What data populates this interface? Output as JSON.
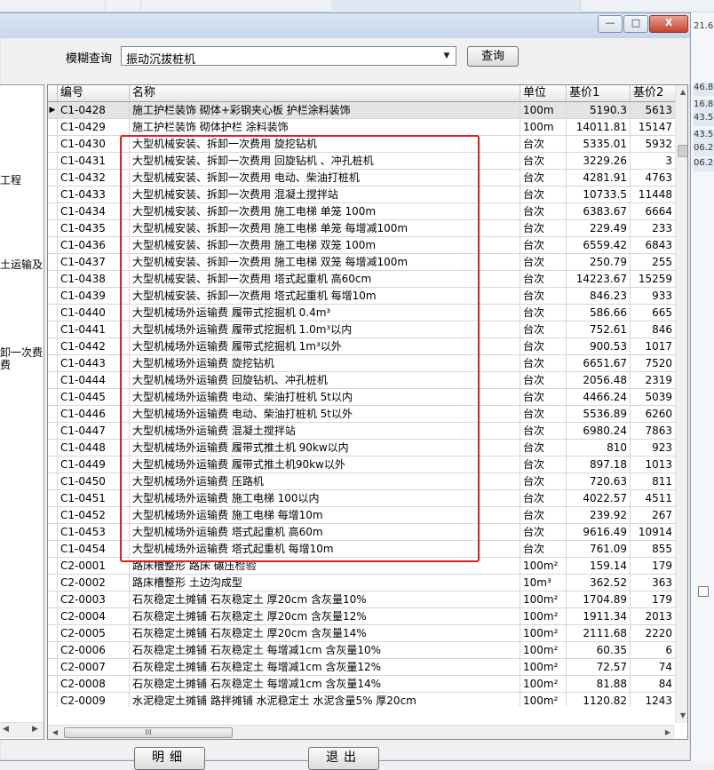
{
  "background": {
    "right_values": [
      "21.6",
      "46.8",
      "16.8",
      "43.5",
      "43.5",
      "06.2",
      "06.2"
    ]
  },
  "window": {
    "min_label": "—",
    "max_label": "□",
    "close_label": "X"
  },
  "filter": {
    "label": "模糊查询",
    "value": "振动沉拔桩机",
    "query_label": "查询"
  },
  "tree": {
    "items": [
      "工程",
      "土运输及",
      "卸一次费",
      "费"
    ]
  },
  "grid": {
    "columns": [
      "编号",
      "名称",
      "单位",
      "基价1",
      "基价2"
    ],
    "rows": [
      {
        "code": "C1-0428",
        "name": "施工护栏装饰 砌体+彩钢夹心板 护栏涂料装饰",
        "unit": "100m",
        "p1": "5190.3",
        "p2": "5613"
      },
      {
        "code": "C1-0429",
        "name": "施工护栏装饰 砌体护栏 涂料装饰",
        "unit": "100m",
        "p1": "14011.81",
        "p2": "15147"
      },
      {
        "code": "C1-0430",
        "name": "大型机械安装、拆卸一次费用 旋挖钻机",
        "unit": "台次",
        "p1": "5335.01",
        "p2": "5932"
      },
      {
        "code": "C1-0431",
        "name": "大型机械安装、拆卸一次费用 回旋钻机 、冲孔桩机",
        "unit": "台次",
        "p1": "3229.26",
        "p2": "3"
      },
      {
        "code": "C1-0432",
        "name": "大型机械安装、拆卸一次费用  电动、柴油打桩机",
        "unit": "台次",
        "p1": "4281.91",
        "p2": "4763"
      },
      {
        "code": "C1-0433",
        "name": "大型机械安装、拆卸一次费用 混凝土搅拌站",
        "unit": "台次",
        "p1": "10733.5",
        "p2": "11448"
      },
      {
        "code": "C1-0434",
        "name": "大型机械安装、拆卸一次费用 施工电梯 单笼 100m",
        "unit": "台次",
        "p1": "6383.67",
        "p2": "6664"
      },
      {
        "code": "C1-0435",
        "name": "大型机械安装、拆卸一次费用 施工电梯 单笼 每增减100m",
        "unit": "台次",
        "p1": "229.49",
        "p2": "233"
      },
      {
        "code": "C1-0436",
        "name": "大型机械安装、拆卸一次费用 施工电梯 双笼 100m",
        "unit": "台次",
        "p1": "6559.42",
        "p2": "6843"
      },
      {
        "code": "C1-0437",
        "name": "大型机械安装、拆卸一次费用 施工电梯 双笼 每增减100m",
        "unit": "台次",
        "p1": "250.79",
        "p2": "255"
      },
      {
        "code": "C1-0438",
        "name": "大型机械安装、拆卸一次费用 塔式起重机 高60cm",
        "unit": "台次",
        "p1": "14223.67",
        "p2": "15259"
      },
      {
        "code": "C1-0439",
        "name": "大型机械安装、拆卸一次费用 塔式起重机 每增10m",
        "unit": "台次",
        "p1": "846.23",
        "p2": "933"
      },
      {
        "code": "C1-0440",
        "name": "大型机械场外运输费 履带式挖掘机 0.4m³",
        "unit": "台次",
        "p1": "586.66",
        "p2": "665"
      },
      {
        "code": "C1-0441",
        "name": "大型机械场外运输费 履带式挖掘机 1.0m³以内",
        "unit": "台次",
        "p1": "752.61",
        "p2": "846"
      },
      {
        "code": "C1-0442",
        "name": "大型机械场外运输费 履带式挖掘机 1m³以外",
        "unit": "台次",
        "p1": "900.53",
        "p2": "1017"
      },
      {
        "code": "C1-0443",
        "name": "大型机械场外运输费 旋挖钻机",
        "unit": "台次",
        "p1": "6651.67",
        "p2": "7520"
      },
      {
        "code": "C1-0444",
        "name": "大型机械场外运输费 回旋钻机、冲孔桩机",
        "unit": "台次",
        "p1": "2056.48",
        "p2": "2319"
      },
      {
        "code": "C1-0445",
        "name": "大型机械场外运输费 电动、柴油打桩机 5t以内",
        "unit": "台次",
        "p1": "4466.24",
        "p2": "5039"
      },
      {
        "code": "C1-0446",
        "name": "大型机械场外运输费 电动、柴油打桩机 5t以外",
        "unit": "台次",
        "p1": "5536.89",
        "p2": "6260"
      },
      {
        "code": "C1-0447",
        "name": "大型机械场外运输费 混凝土搅拌站",
        "unit": "台次",
        "p1": "6980.24",
        "p2": "7863"
      },
      {
        "code": "C1-0448",
        "name": "大型机械场外运输费 履带式推土机 90kw以内",
        "unit": "台次",
        "p1": "810",
        "p2": "923"
      },
      {
        "code": "C1-0449",
        "name": "大型机械场外运输费 履带式推土机90kw以外",
        "unit": "台次",
        "p1": "897.18",
        "p2": "1013"
      },
      {
        "code": "C1-0450",
        "name": "大型机械场外运输费 压路机",
        "unit": "台次",
        "p1": "720.63",
        "p2": "811"
      },
      {
        "code": "C1-0451",
        "name": "大型机械场外运输费 施工电梯 100以内",
        "unit": "台次",
        "p1": "4022.57",
        "p2": "4511"
      },
      {
        "code": "C1-0452",
        "name": "大型机械场外运输费 施工电梯 每增10m",
        "unit": "台次",
        "p1": "239.92",
        "p2": "267"
      },
      {
        "code": "C1-0453",
        "name": "大型机械场外运输费 塔式起重机 高60m",
        "unit": "台次",
        "p1": "9616.49",
        "p2": "10914"
      },
      {
        "code": "C1-0454",
        "name": "大型机械场外运输费 塔式起重机 每增10m",
        "unit": "台次",
        "p1": "761.09",
        "p2": "855"
      },
      {
        "code": "C2-0001",
        "name": "路床槽整形 路床 碾压检验",
        "unit": "100m²",
        "p1": "159.14",
        "p2": "179"
      },
      {
        "code": "C2-0002",
        "name": "路床槽整形 土边沟成型",
        "unit": "10m³",
        "p1": "362.52",
        "p2": "363"
      },
      {
        "code": "C2-0003",
        "name": "石灰稳定土摊铺 石灰稳定土 厚20cm 含灰量10%",
        "unit": "100m²",
        "p1": "1704.89",
        "p2": "179"
      },
      {
        "code": "C2-0004",
        "name": "石灰稳定土摊铺 石灰稳定土 厚20cm 含灰量12%",
        "unit": "100m²",
        "p1": "1911.34",
        "p2": "2013"
      },
      {
        "code": "C2-0005",
        "name": "石灰稳定土摊铺 石灰稳定土 厚20cm 含灰量14%",
        "unit": "100m²",
        "p1": "2111.68",
        "p2": "2220"
      },
      {
        "code": "C2-0006",
        "name": "石灰稳定土摊铺 石灰稳定土 每增减1cm 含灰量10%",
        "unit": "100m²",
        "p1": "60.35",
        "p2": "6"
      },
      {
        "code": "C2-0007",
        "name": "石灰稳定土摊铺 石灰稳定土 每增减1cm 含灰量12%",
        "unit": "100m²",
        "p1": "72.57",
        "p2": "74"
      },
      {
        "code": "C2-0008",
        "name": "石灰稳定土摊铺 石灰稳定土 每增减1cm 含灰量14%",
        "unit": "100m²",
        "p1": "81.88",
        "p2": "84"
      },
      {
        "code": "C2-0009",
        "name": "水泥稳定土摊铺 路拌摊铺 水泥稳定土 水泥含量5% 厚20cm",
        "unit": "100m²",
        "p1": "1120.82",
        "p2": "1243"
      }
    ],
    "selected_indicator": "▶",
    "scroll_thumb_label": "III"
  },
  "buttons": {
    "detail_label": "明细",
    "exit_label": "退出"
  },
  "colors": {
    "highlight_border": "#e02020",
    "selected_row": "#e4e4e4"
  }
}
